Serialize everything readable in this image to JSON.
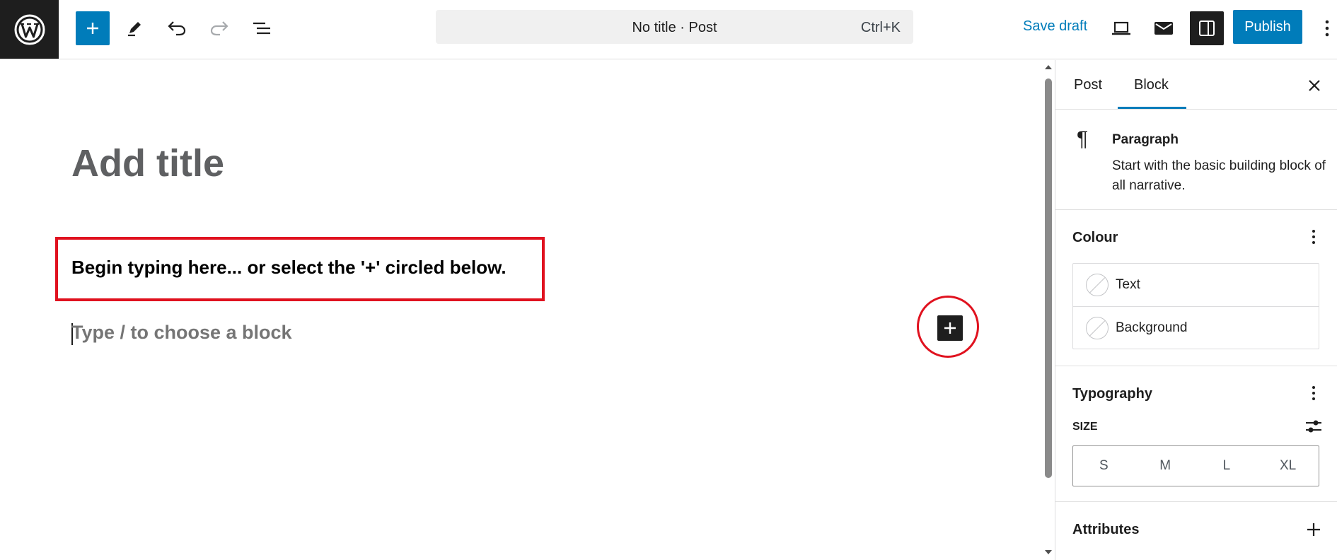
{
  "header": {
    "command_title": "No title · Post",
    "command_shortcut": "Ctrl+K",
    "save_draft_label": "Save draft",
    "publish_label": "Publish"
  },
  "editor": {
    "title_placeholder": "Add title",
    "paragraph_text": "Begin typing here... or select the '+' circled below.",
    "block_placeholder": "Type / to choose a block"
  },
  "sidebar": {
    "tabs": [
      {
        "label": "Post",
        "active": false
      },
      {
        "label": "Block",
        "active": true
      }
    ],
    "block": {
      "name": "Paragraph",
      "description": "Start with the basic building block of all narrative."
    },
    "colour": {
      "heading": "Colour",
      "items": [
        {
          "label": "Text"
        },
        {
          "label": "Background"
        }
      ]
    },
    "typography": {
      "heading": "Typography",
      "size_label": "SIZE",
      "sizes": [
        "S",
        "M",
        "L",
        "XL"
      ]
    },
    "attributes": {
      "heading": "Attributes"
    }
  },
  "colors": {
    "accent": "#007cba",
    "dark": "#1e1e1e",
    "annotation_red": "#e0121f"
  },
  "icons": {
    "logo": "wordpress-logo-icon",
    "inserter": "plus-icon",
    "tools": "pencil-icon",
    "undo": "undo-icon",
    "redo": "redo-icon",
    "outline": "list-view-icon",
    "preview": "laptop-icon",
    "email": "envelope-icon",
    "settings": "sidebar-icon",
    "options": "vertical-ellipsis-icon",
    "close": "close-icon",
    "block_type": "pilcrow-icon",
    "size_controls": "sliders-icon"
  }
}
